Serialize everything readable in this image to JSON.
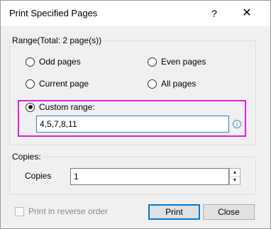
{
  "dialog": {
    "title": "Print Specified Pages",
    "help_glyph": "?",
    "close_glyph": "✕"
  },
  "range": {
    "legend": "Range(Total: 2 page(s))",
    "options": {
      "odd": {
        "label": "Odd pages",
        "checked": false
      },
      "even": {
        "label": "Even pages",
        "checked": false
      },
      "current": {
        "label": "Current page",
        "checked": false
      },
      "all": {
        "label": "All pages",
        "checked": false
      },
      "custom": {
        "label": "Custom range:",
        "checked": true
      }
    },
    "custom_value": "4,5,7,8,11",
    "info_glyph": "i"
  },
  "copies": {
    "legend": "Copies:",
    "label": "Copies",
    "value": "1"
  },
  "footer": {
    "reverse_label": "Print in reverse order",
    "reverse_checked": false,
    "print_label": "Print",
    "close_label": "Close"
  },
  "colors": {
    "highlight": "#e020e0",
    "input_border": "#3c7fb1",
    "default_button_border": "#0078d7"
  },
  "icons": {
    "help": "help-icon",
    "close": "close-icon",
    "info": "info-icon",
    "spin_up": "chevron-up-icon",
    "spin_down": "chevron-down-icon"
  }
}
